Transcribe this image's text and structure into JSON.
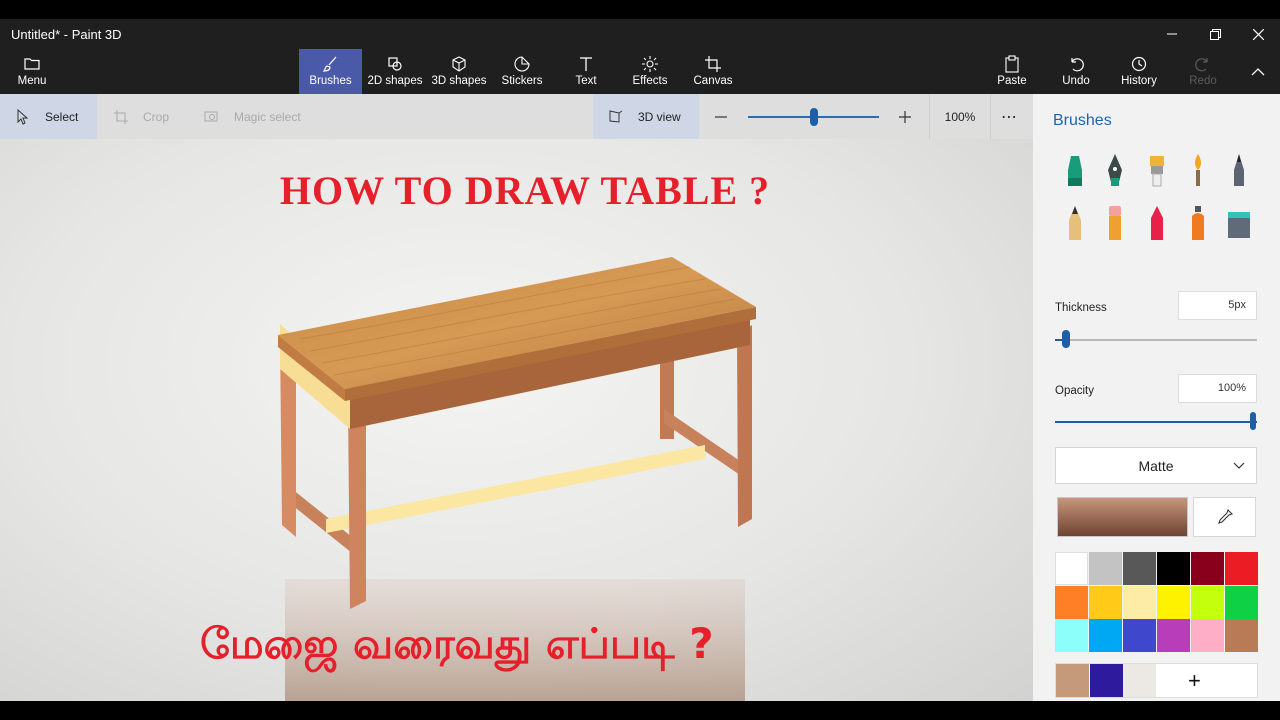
{
  "window": {
    "title": "Untitled* - Paint 3D"
  },
  "ribbon": {
    "menu_label": "Menu",
    "tabs": [
      {
        "label": "Brushes",
        "icon": "brush-icon",
        "active": true
      },
      {
        "label": "2D shapes",
        "icon": "2d-shapes-icon"
      },
      {
        "label": "3D shapes",
        "icon": "3d-shapes-icon"
      },
      {
        "label": "Stickers",
        "icon": "stickers-icon"
      },
      {
        "label": "Text",
        "icon": "text-icon"
      },
      {
        "label": "Effects",
        "icon": "effects-icon"
      },
      {
        "label": "Canvas",
        "icon": "canvas-icon"
      }
    ],
    "actions": [
      {
        "label": "Paste",
        "icon": "paste-icon"
      },
      {
        "label": "Undo",
        "icon": "undo-icon"
      },
      {
        "label": "History",
        "icon": "history-icon"
      },
      {
        "label": "Redo",
        "icon": "redo-icon",
        "disabled": true
      }
    ]
  },
  "toolbar": {
    "select_label": "Select",
    "crop_label": "Crop",
    "magic_select_label": "Magic select",
    "view3d_label": "3D view",
    "zoom_level": "100%",
    "zoom_fraction": 0.5
  },
  "canvas": {
    "heading": "HOW TO DRAW TABLE ?",
    "tamil_heading": "மேஜை வரைவது எப்படி ?"
  },
  "panel": {
    "title": "Brushes",
    "brushes": [
      "marker-icon",
      "calligraphy-pen-icon",
      "oil-brush-icon",
      "watercolor-icon",
      "pixel-pen-icon",
      "pencil-icon",
      "eraser-icon",
      "crayon-icon",
      "spray-can-icon",
      "fill-bucket-icon"
    ],
    "thickness_label": "Thickness",
    "thickness_value": "5px",
    "thickness_fraction": 0.04,
    "opacity_label": "Opacity",
    "opacity_value": "100%",
    "opacity_fraction": 1.0,
    "material": "Matte",
    "palette": [
      "#ffffff",
      "#c3c3c3",
      "#585858",
      "#000000",
      "#88001b",
      "#ec1c24",
      "#ff7f27",
      "#ffca18",
      "#fdeca6",
      "#fff200",
      "#c4ff0e",
      "#0ed145",
      "#8cfffb",
      "#00a8f3",
      "#3f48cc",
      "#b83dba",
      "#ffaec8",
      "#b97a56"
    ],
    "custom_colors": [
      "#c59a7a",
      "#2e1a9c",
      "#ece9e4"
    ],
    "current_color_from": "#c8957a",
    "current_color_to": "#6e4433"
  }
}
